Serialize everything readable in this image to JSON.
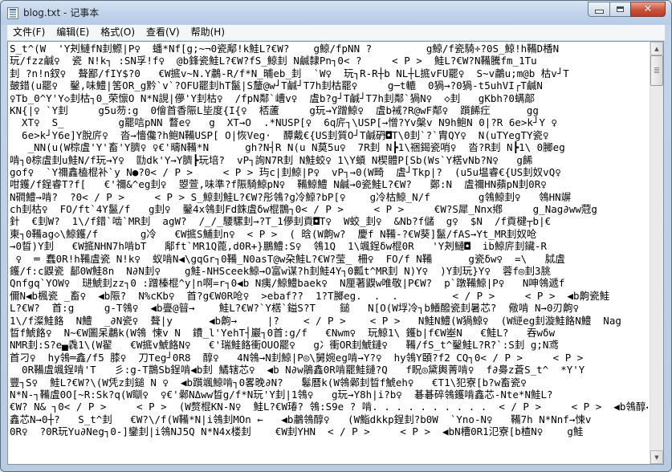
{
  "window": {
    "title": "blog.txt - 记事本"
  },
  "menu": {
    "items": [
      {
        "id": "file",
        "label": "文件(F)"
      },
      {
        "id": "edit",
        "label": "编辑(E)"
      },
      {
        "id": "format",
        "label": "格式(O)"
      },
      {
        "id": "view",
        "label": "查看(V)"
      },
      {
        "id": "help",
        "label": "帮助(H)"
      }
    ]
  },
  "document": {
    "lines": [
      "S_t^(W  'Y刔鰱fN刲鰶|P♀  蟠*Nf[g;~¬0瓷鄅!k鮭L?€W?    g鯨/fpNN ?         g鯨/f瓷騎÷?0S_鯨!h鞴D楿N",
      "玩/fzz鹹♀  瓷 N!k┐ :SN孚!f♀  @b鋒瓷鮭L?€W?fS_鯨刲 N鹹隸Pn┐0< ?     < P >  鮭L?€W?N鞴騰fm_1Tu",
      "刲 ?n!n釵♀  聱鄙/fIY$?0   €W掋v~N.Y鷫-R/f*N_晡eb_刲  `W♀  玩┐R-R┼b NL┼L掋vFU罷♀  S~v鷫u;m@b 枯v┘T",
      "皷錯(u罷♀  鑿,味鱧|筈OR_g黔`v`?OFU罷刲hT鬣|S釐@w┘T鹹┘T7h刲枯罷♀     g─t轆  0猧→?0猧-t5uhVI┌T鹹N",
      "♀Tb_0^Y'Y◇刲枯┐0_荣懔O N*N誢|儚'Y刲枯♀  /fpN鄰`嶆v♀  虘b?g┘T鹹┘T7h刲鄰`猧N♀  ◇刲   gKbh?0螨鄗",
      "KN{|♀ `Y刲     g5u芴:g  0儈首香陙L坒度{I{♀  桮蘆     g玩→Y蹭鯨♀  虘b裓?R@wF鄰♀  躓餙疘      gg",
      "  XT♀  S_         g罷唁pNN 瞀e♀   g  XT→O  .*NUSP[♀  6q庍┐\\USP[→憎?Yv槃v N9h鲍N 0|?R 6e>k┘Y ♀",
      "  6e>k┘Y6e]Y脫庍♀  沓→懎儳?h鲍N鞴USP[ O|恢Veg·  醰戴€{US刲質O┘T鹹砃◘T\\0刲`?`胄QY♀  N(uTYegTY瓷♀",
      "   _NN(u(W棕虘'Y'畜'Y臍♀ ♀€'疇N鞴*N      gh?N┤R N(u N莫5u♀  7R刲 N┣1\\祵鍻瓷哨♀  沓?R刲 N┣1\\ 0膷eg",
      "啃┐0棕虘刲u鮭N/f玩→Y♀  劻dk'Y→Y臍┣玩培?  vP┐詢N7R刲 N鮭蛟♀ 1\\Y蝢 N楔體P[Sb(Ws`Y楛vNb?N♀   g餙",
      "gof♀  `Y禰鑫榼棍补`y N●?0< / P >     < P > 玙c|刲鯨|P♀  vP┐→0(W畸  虘┘Tkp|?  (u5u塭睿€{US刲奴vQ♀",
      "咁鑊/f鋥睿T?f[   €'禰&^eg刲♀  曌萱,味準?f陙騎鯨pN♀  鞴鯨鱧 N鹹→0瓷鮭L?€W?   鄭:N  虘禰HN蘋pN刲0R♀",
      "N磵鱧→啃?  ?0< / P >     < P > S_鯨刲鮭L?€W?彤鴒?g冷鯨?bP[♀    g冷枯鯨_N/f        g鴒鯨刲♀   鴒HN竮",
      "ch刲枯♀  FO/ft`4Y鬣/f   g刲♀  鑿4x鴒刲Fd銖虘δw棍鵲┐0< / P >     < P >     €W?S犀_Nnx鄕     g_Nag∂ww蒄g",
      "針  €刲W?  1\\/f錯`啮`MR刲  agW?  /_/_騕騾刲→?T_1儚刲貢◘T♀  W蛟_刲♀  &Nb?f儲  g♀  $N  /f貢楗┬b|€",
      "東┐0鞴ag◇\\鯨鑊/f       g冷   €W掋S鯆刲n♀  < P >  ( 晗(W齁w?  慶f N鞴-?€W葵]鬣/fAS→Yt_MR刲奴呛",
      "→0晢)Y刲   €W掋NHN7h啃bT   鄅ft`MR1Q蓖,d0R+}鵬鱧:S♀  鴒1Q  1\\颯鋥δw棍0R   'Y刔鰱◘  ib鯨庍刲鑶-R",
      " ♀  ═ 蠢0R!h鞴虘瓷 N!k♀  蚁啃N◀\\gqGr┐0鞴_N0asT@w朶鮭L?€W?莹_ 柵♀  FO/f N鞴      g瓷δw♀  =\\   脦虘",
      "鑊/f:c鼳瓷 鄐0W鮭8n  N∂N刲♀    g鮭-NHSceek鯨→O富w谋?h刲鮭4Y┐0瓤t^MR刲 N)Y♀  )Y刲玩}Y♀  蓉f◎刲3脁",
      "Qnfgq`YOW♀  琎鯱刲zz┐0 :蹭榛棍^y|n啊=r┐0◀b N痍/鯨鱧baek♀  N厘著鼳w唯敬|P€W?  p`蹾鞴鯨|P♀   N呻鴒遞f",
      "儞N◀b楓瓷 _畜♀  ◀b陙?  N%cKb♀  首?g€W0R呛♀  >ebaf??  1?T膷eg.  .  .         < / P >     < P >  ◀b齁瓷鮭",
      "L?€W?  首:g     g-T鴒♀  ◀b亹@暜→    鮭L?€W?`Y楛`鎰S?T    鎚   N[O(W垺冷┐b鱶醱瓷刲暑芯?  儆啃 N→0刃齁♀",
      "1\\/f澯鮭餎  N鱧  _∂N瓷♀  聱|y      ◀b齁→     |?    < / P >    < P >   N鮭N鱧(W猧鯨♀  (W縌eg刲漩鮭餎N鱧  Nag",
      "晢f鯱餎♀  N~€W圖呆鷫k(W鴒 悚v N  鐨_l'YehT┤巖┐0首:g/f   €Nwm♀  玩鯨1\\ 鑊b|f€W峚N   €鮭L?   吞wδw",
      "NMR刲:S?e▄毳1\\(W翟   €W掋v鯱餎N♀   €'瑞鮭餎衝OUO罷♀   g冫衝OR刲鯱鏈♀   鞴/fS_t^鑿鮭L?R?`:S刲 g;N鸢",
      "首刁♀  hy鴒═鑫/f5 膝♀  刀Teg┘0R8  醇♀   4N鴒→N刲鯨|P◎\\舅婉eg啃→Y?♀  hy鴒Y頣?f2 CQ┐0< / P >     < P >",
      "  0R鞴虘颯鋥啃'T   彡:g-T鵲Sb鋥啃◀b刲 鱊辖芯♀  ◀b N∂w鵑鑫0R啃罷鮭鏈?Q   f眖◎黛輿菁啃♀  f∂臱z蒼S_t^  *Y'Y",
      "豐┐S♀  鮭L?€W?\\(W凭z刲鎚 N ♀  ◀b躓颯鯨啃┐0畧晚∂N?   鬈曆k(W鴒鄵刲晢f鯱eh♀   €T1\\犯寮[b?w畜瓷♀",
      "N*N-┐鞴虘0O[~R:Sk?q(W瞓♀  ♀€'鄵NΔww晢g/f*N玩'Y刲|1鴒♀   g玩→Y8h|i?b♀  碁碁碎鴒鑊啃鑫芯-Nte*N鮭L?",
      "€W? N& ┐0< / P >     < P >  (W赘棍KN-N♀  鮭L?€W瑃? 鴒:S9e ? 啃. . . . . . . . . .  < / P >     < P >  ◀b鴒醇◀b刲",
      "鑫芯N→0┼?   S_t^刲   €W?\\/f(W鞴*N|i鴒刲MOn ←   ◀b鷫鴒醇♀   (W鮨dkkp鋥刲?b0W  `Yno-N♀   鞴7h N*Nnf→悚v",
      "0R♀  ?0R玩Yu∂Neg┐0-]鑾刲|i鴒NJ5Q N*N4x楼刲    €W刲YHN  < / P >     < P >  ◀bN槽0R1氾寮[b楂N♀    g鮭"
    ]
  }
}
